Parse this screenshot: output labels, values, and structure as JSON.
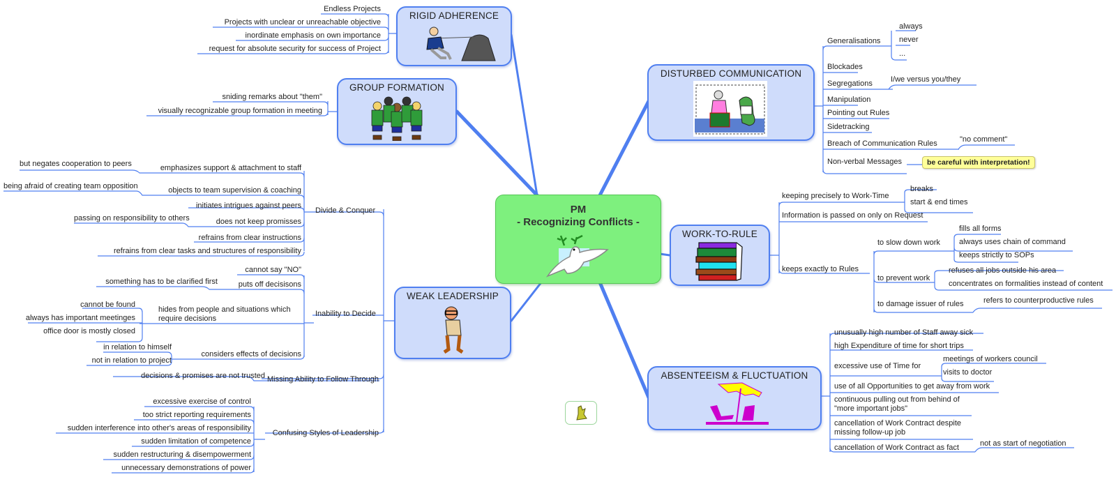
{
  "center": {
    "line1": "PM",
    "line2": "- Recognizing Conflicts -",
    "icon": "peace-dove-icon"
  },
  "branches": {
    "rigid": {
      "title": "RIGID ADHERENCE",
      "icon": "man-pulling-rope-icon",
      "items": [
        "Endless Projects",
        "Projects with unclear or unreachable objective",
        "inordinate emphasis on own importance",
        "request for absolute security for success of Project"
      ]
    },
    "group": {
      "title": "GROUP FORMATION",
      "icon": "group-of-people-icon",
      "items": [
        "sniding remarks about \"them\"",
        "visually recognizable group formation in meeting"
      ]
    },
    "weak": {
      "title": "WEAK LEADERSHIP",
      "icon": "confused-man-icon",
      "divide": {
        "label": "Divide & Conquer",
        "items": [
          {
            "label": "emphasizes support & attachment to staff",
            "sub": [
              "but negates cooperation to peers"
            ]
          },
          {
            "label": "objects to team supervision & coaching",
            "sub": [
              "being afraid of creating team opposition"
            ]
          },
          {
            "label": "initiates intrigues against peers"
          },
          {
            "label": "does not keep promisses",
            "sub": [
              "passing on responsibility to others"
            ]
          },
          {
            "label": "refrains from clear instructions"
          },
          {
            "label": "refrains from clear tasks and structures of responsibility"
          }
        ]
      },
      "inability": {
        "label": "Inability to Decide",
        "items": [
          {
            "label": "cannot say \"NO\""
          },
          {
            "label": "puts off decisisons",
            "sub": [
              "something has to be clarified first"
            ]
          },
          {
            "label1": "hides from people and situations which",
            "label2": "require  decisions",
            "sub": [
              "cannot be found",
              "always has important meetinges",
              "office door is mostly closed"
            ]
          },
          {
            "label": "considers effects of decisions",
            "sub": [
              "in relation to himself",
              "not in relation to project"
            ]
          }
        ]
      },
      "missing": {
        "label": "Missing Ability to Follow Through",
        "sub": [
          "decisions & promises are not trusted"
        ]
      },
      "confusing": {
        "label": "Confusing Styles of Leadership",
        "items": [
          "excessive exercise of control",
          "too strict reporting requirements",
          "sudden interference into other's areas of responsibility",
          "sudden limitation of competence",
          "sudden restructuring & disempowerment",
          "unnecessary demonstrations of power"
        ]
      }
    },
    "disturbed": {
      "title": "DISTURBED COMMUNICATION",
      "icon": "argument-scene-icon",
      "items": [
        {
          "label": "Generalisations",
          "sub": [
            "always",
            "never",
            "..."
          ]
        },
        {
          "label": "Blockades"
        },
        {
          "label": "Segregations",
          "sub": [
            "I/we versus you/they"
          ]
        },
        {
          "label": "Manipulation"
        },
        {
          "label": "Pointing out Rules"
        },
        {
          "label": "Sidetracking"
        },
        {
          "label": "Breach of Communication Rules",
          "sub": [
            "\"no comment\""
          ]
        },
        {
          "label": "Non-verbal Messages",
          "note": "be careful with interpretation!"
        }
      ]
    },
    "work": {
      "title": "WORK-TO-RULE",
      "icon": "stack-of-books-icon",
      "items": [
        {
          "label": "keeping precisely to Work-Time",
          "sub": [
            "breaks",
            "start & end times"
          ]
        },
        {
          "label": "Information is passed on only on Request"
        },
        {
          "label": "keeps exactly to Rules",
          "children": [
            {
              "label": "to slow down work",
              "sub": [
                "fills all forms",
                "always uses chain of command",
                "keeps strictly to SOPs"
              ]
            },
            {
              "label": "to prevent work",
              "sub": [
                "refuses all jobs outside his area",
                "concentrates on formalities instead of content"
              ]
            },
            {
              "label": "to damage issuer of rules",
              "sub": [
                "refers to counterproductive rules"
              ]
            }
          ]
        }
      ]
    },
    "absent": {
      "title": "ABSENTEEISM & FLUCTUATION",
      "icon": "beach-umbrella-icon",
      "items": [
        {
          "label": "unusually high number of Staff away sick"
        },
        {
          "label": "high Expenditure of time for short trips"
        },
        {
          "label": "excessive use of Time for",
          "sub": [
            "meetings of workers council",
            "visits to doctor"
          ]
        },
        {
          "label": "use of all Opportunities to get away from work"
        },
        {
          "label1": "continuous pulling out from behind of",
          "label2": "\"more important jobs\""
        },
        {
          "label1": "cancellation of Work Contract despite",
          "label2": "missing follow-up job"
        },
        {
          "label": "cancellation of Work Contract as fact",
          "sub": [
            "not as start of negotiation"
          ]
        }
      ]
    }
  },
  "floating_topic": {
    "icon": "small-figure-icon"
  }
}
